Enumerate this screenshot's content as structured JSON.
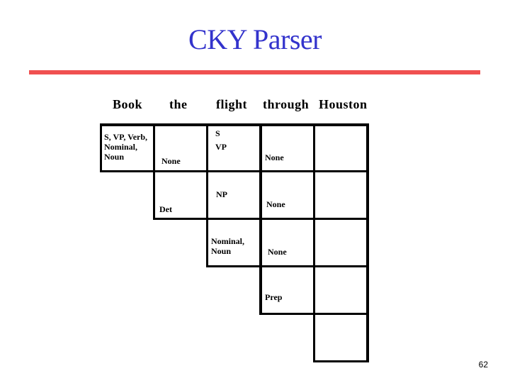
{
  "slide": {
    "title": "CKY Parser",
    "page_number": "62",
    "colors": {
      "title": "#3333cc",
      "rule": "#f05050",
      "grid": "#000000"
    }
  },
  "words": [
    "Book",
    "the",
    "flight",
    "through",
    "Houston"
  ],
  "cells": {
    "c0_1": "S, VP, Verb,\nNominal,\nNoun",
    "c0_2": "None",
    "c0_3": "S\nVP",
    "c0_4": "None",
    "c0_5": "",
    "c1_2": "Det",
    "c1_3": "NP",
    "c1_4": "None",
    "c1_5": "",
    "c2_3": "Nominal,\nNoun",
    "c2_4": "None",
    "c2_5": "",
    "c3_4": "Prep",
    "c3_5": "",
    "c4_5": ""
  }
}
